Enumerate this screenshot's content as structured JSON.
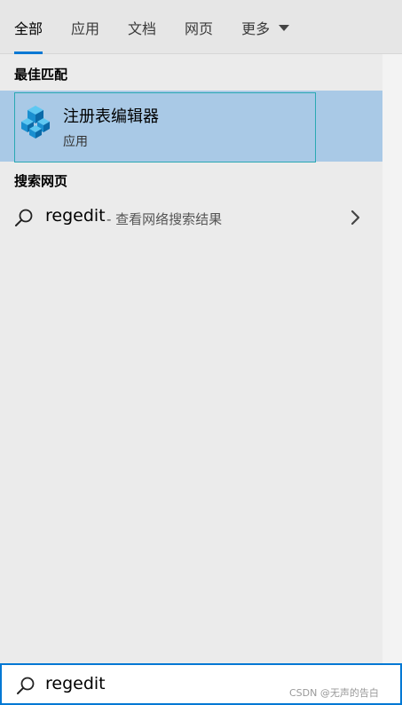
{
  "tabs": [
    {
      "label": "全部",
      "active": true
    },
    {
      "label": "应用"
    },
    {
      "label": "文档"
    },
    {
      "label": "网页"
    },
    {
      "label": "更多"
    }
  ],
  "sections": {
    "best_match": "最佳匹配",
    "web_search": "搜索网页"
  },
  "best_match": {
    "name": "注册表编辑器",
    "kind": "应用",
    "icon": "registry-editor-icon"
  },
  "web_result": {
    "query": "regedit",
    "hint": "- 查看网络搜索结果",
    "icon": "search-icon",
    "arrow_icon": "chevron-right-icon"
  },
  "searchbar": {
    "value": "regedit",
    "icon": "search-icon",
    "accent": "#0078d4"
  },
  "watermark": "CSDN @无声的告白",
  "colors": {
    "accent": "#0078d4",
    "selection": "#a9c9e6",
    "selection_border": "#2aa8b3"
  }
}
